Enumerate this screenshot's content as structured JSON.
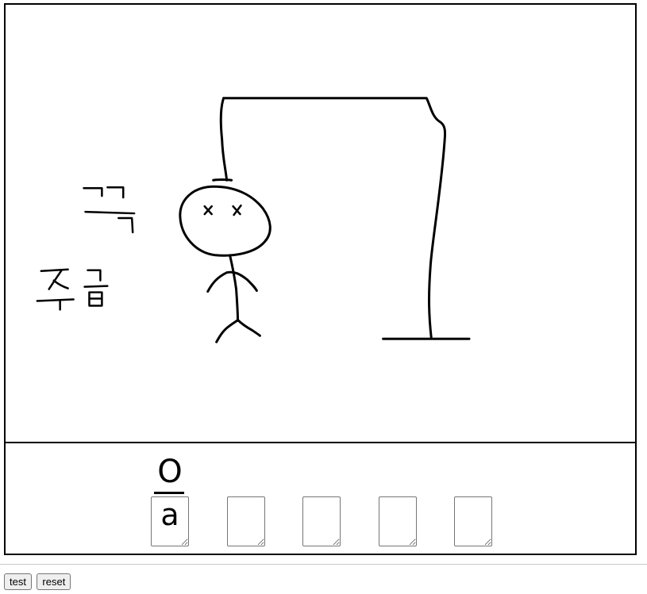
{
  "canvas": {
    "doodle_text_1": "끅",
    "doodle_text_2": "주금"
  },
  "answer": {
    "slots": [
      {
        "mark": "O",
        "value": "a"
      },
      {
        "mark": "",
        "value": ""
      },
      {
        "mark": "",
        "value": ""
      },
      {
        "mark": "",
        "value": ""
      },
      {
        "mark": "",
        "value": ""
      }
    ]
  },
  "controls": {
    "test_label": "test",
    "reset_label": "reset"
  }
}
